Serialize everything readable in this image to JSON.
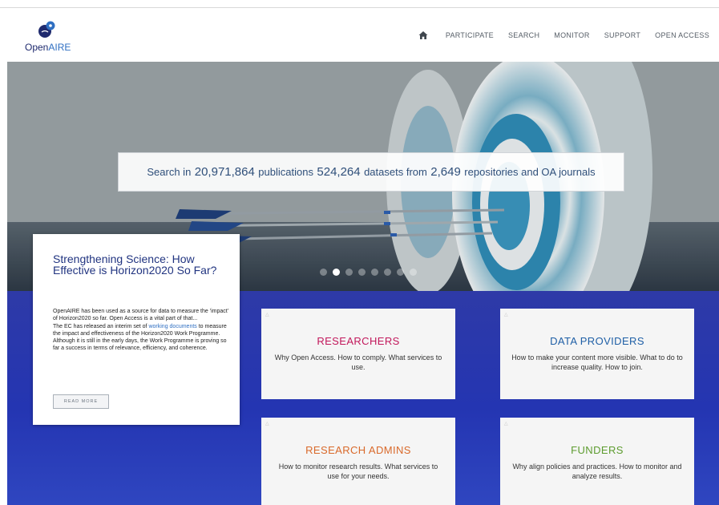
{
  "brand": {
    "name_part1": "Open",
    "name_part2": "AIRE"
  },
  "nav": {
    "home_icon": "home-icon",
    "items": [
      "PARTICIPATE",
      "SEARCH",
      "MONITOR",
      "SUPPORT",
      "OPEN ACCESS"
    ]
  },
  "hero": {
    "search": {
      "prefix": "Search in",
      "publications_count": "20,971,864",
      "publications_label": "publications",
      "datasets_count": "524,264",
      "datasets_label": "datasets from",
      "repositories_count": "2,649",
      "repositories_label": "repositories and OA journals"
    },
    "carousel": {
      "slides": 8,
      "active_index": 1
    }
  },
  "news": {
    "title": "Strengthening Science: How Effective is Horizon2020 So Far?",
    "body_part1": "OpenAIRE has been used as a source for data to measure the 'impact' of Horizon2020 so far. Open Access is a vital part of that...",
    "body_part2": "The EC has released an interim set of",
    "link_text": "working documents",
    "body_part3": "to measure the impact and effectiveness of the Horizon2020 Work Programme. Although it is still in the early days, the Work Programme is proving so far a success in terms of relevance, efficiency, and coherence.",
    "read_more": "READ MORE"
  },
  "tiles": {
    "researchers": {
      "title": "RESEARCHERS",
      "text": "Why Open Access. How to comply. What services to use.",
      "color": "#c2185b"
    },
    "data_providers": {
      "title": "DATA PROVIDERS",
      "text": "How to make your content more visible. What to do to increase quality. How to join.",
      "color": "#1f5fa6"
    },
    "research_admins": {
      "title": "RESEARCH ADMINS",
      "text": "How to monitor research results. What services to use for your needs.",
      "color": "#d9692a"
    },
    "funders": {
      "title": "FUNDERS",
      "text": "Why align policies and practices. How to monitor and analyze results.",
      "color": "#5d9c2f"
    }
  },
  "colors": {
    "brand_dark": "#1f2a6e",
    "brand_blue": "#2f6fc2",
    "lower_bg": "#2a36a8"
  }
}
